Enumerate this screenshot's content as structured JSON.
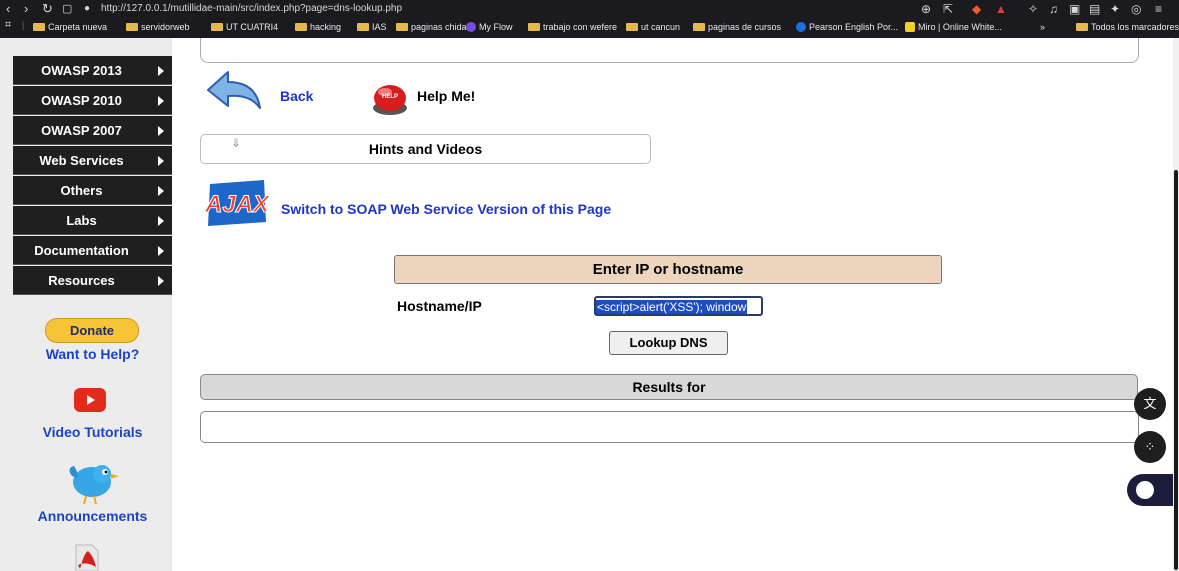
{
  "browser": {
    "url": "http://127.0.0.1/mutillidae-main/src/index.php?page=dns-lookup.php",
    "bookmarks": [
      {
        "label": "Carpeta nueva",
        "type": "folder"
      },
      {
        "label": "servidorweb",
        "type": "folder"
      },
      {
        "label": "UT CUATRI4",
        "type": "folder"
      },
      {
        "label": "hacking",
        "type": "folder"
      },
      {
        "label": "IAS",
        "type": "folder"
      },
      {
        "label": "paginas chidas",
        "type": "folder"
      },
      {
        "label": "My Flow",
        "type": "site"
      },
      {
        "label": "trabajo con wefere",
        "type": "folder"
      },
      {
        "label": "ut cancun",
        "type": "folder"
      },
      {
        "label": "paginas de cursos",
        "type": "folder"
      },
      {
        "label": "Pearson English Por...",
        "type": "site"
      },
      {
        "label": "Miro | Online White...",
        "type": "site"
      }
    ],
    "more": "»",
    "all_bookmarks": "Todos los marcadores"
  },
  "sidebar": {
    "menu": [
      {
        "label": "OWASP 2013"
      },
      {
        "label": "OWASP 2010"
      },
      {
        "label": "OWASP 2007"
      },
      {
        "label": "Web Services"
      },
      {
        "label": "Others"
      },
      {
        "label": "Labs"
      },
      {
        "label": "Documentation"
      },
      {
        "label": "Resources"
      }
    ],
    "donate": "Donate",
    "want_help": "Want to Help?",
    "video_tutorials": "Video Tutorials",
    "announcements": "Announcements"
  },
  "main": {
    "back": "Back",
    "help": "Help Me!",
    "help_badge": "HELP",
    "hints": "Hints and Videos",
    "ajax_logo": "AJAX",
    "soap_link": "Switch to SOAP Web Service Version of this Page",
    "form_header": "Enter IP or hostname",
    "hostname_label": "Hostname/IP",
    "hostname_value": "<script>alert('XSS'); window",
    "lookup_button": "Lookup DNS",
    "results_header": "Results for"
  }
}
